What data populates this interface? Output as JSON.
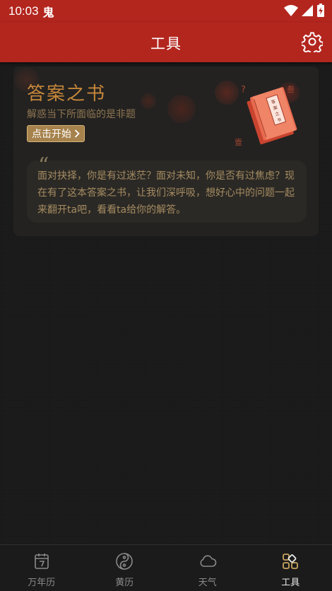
{
  "status_bar": {
    "time": "10:03",
    "app_icon_char": "鬼"
  },
  "app_bar": {
    "title": "工具",
    "settings_icon": "gear-icon"
  },
  "card": {
    "title": "答案之书",
    "subtitle": "解惑当下所面临的是非题",
    "start_button_label": "点击开始",
    "start_button_icon": "chevron-right-icon",
    "quote_mark": "“",
    "quote_text": "面对抉择，你是有过迷茫？面对未知，你是否有过焦虑？现在有了这本答案之书，让我们深呼吸，想好心中的问题一起来翻开ta吧，看看ta给你的解答。",
    "book_cover_text": "答案之书"
  },
  "bottom_nav": {
    "items": [
      {
        "label": "万年历",
        "icon": "calendar-icon",
        "active": false
      },
      {
        "label": "黄历",
        "icon": "yin-yang-icon",
        "active": false
      },
      {
        "label": "天气",
        "icon": "cloud-icon",
        "active": false
      },
      {
        "label": "工具",
        "icon": "grid-tools-icon",
        "active": true
      }
    ]
  },
  "colors": {
    "primary_red": "#b3261e",
    "background": "#1a1a1a",
    "card_bg": "#232221",
    "gold_title": "#c7873a",
    "button_gold": "#a6824c",
    "active_icon": "#c9a45e"
  }
}
